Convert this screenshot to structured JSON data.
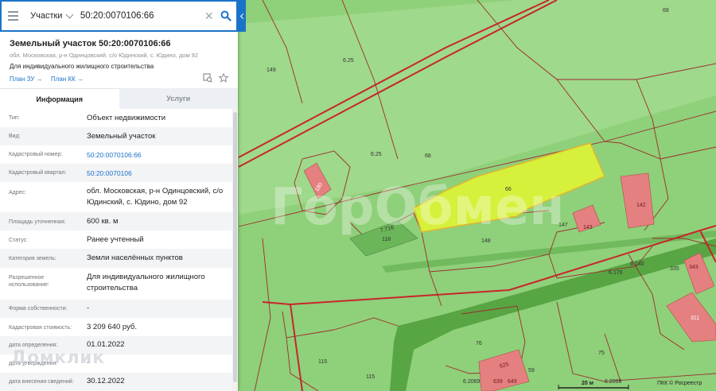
{
  "search": {
    "menu_icon": "menu-icon",
    "category": "Участки",
    "query": "50:20:0070106:66",
    "clear_icon": "close-icon",
    "search_icon": "search-icon"
  },
  "object": {
    "title": "Земельный участок 50:20:0070106:66",
    "address": "обл. Московская, р-н Одинцовский, с/о Юдинский, с. Юдино, дом 92",
    "use": "Для индивидуального жилищного строительства",
    "plan_zu": "План ЗУ →",
    "plan_kk": "План КК →",
    "tool_icons": [
      "map-zoom-icon",
      "star-icon"
    ]
  },
  "tabs": [
    {
      "label": "Информация",
      "active": true
    },
    {
      "label": "Услуги",
      "active": false
    }
  ],
  "info_rows": [
    {
      "key": "Тип:",
      "value": "Объект недвижимости"
    },
    {
      "key": "Вид:",
      "value": "Земельный участок"
    },
    {
      "key": "Кадастровый номер:",
      "value": "50:20:0070106:66",
      "link": true
    },
    {
      "key": "Кадастровый квартал:",
      "value": "50:20:0070106",
      "link": true
    },
    {
      "key": "Адрес:",
      "value": "обл. Московская, р-н Одинцовский, с/о Юдинский, с. Юдино, дом 92"
    },
    {
      "key": "Площадь уточненная:",
      "value": "600 кв. м"
    },
    {
      "key": "Статус:",
      "value": "Ранее учтенный"
    },
    {
      "key": "Категория земель:",
      "value": "Земли населённых пунктов"
    },
    {
      "key": "Разрешенное использование:",
      "value": "Для индивидуального жилищного строительства"
    },
    {
      "key": "Форма собственности:",
      "value": "-"
    },
    {
      "key": "Кадастровая стоимость:",
      "value": "3 209 640 руб."
    },
    {
      "key": "дата определения:",
      "value": "01.01.2022"
    },
    {
      "key": "дата утверждения:",
      "value": "-"
    },
    {
      "key": "дата внесения сведений:",
      "value": "30.12.2022"
    }
  ],
  "watermarks": {
    "map": "ГорОбмен",
    "panel": "Домклик"
  },
  "map_labels": {
    "l68a": "68",
    "l6_25a": "6.25",
    "l149": "149",
    "l6_25b": "6.25",
    "l68b": "68",
    "l180": "180",
    "l66": "66",
    "l7716": "7.716",
    "l118": "118",
    "l148": "148",
    "l147": "147",
    "l143": "143",
    "l142": "142",
    "l6140": "6.140",
    "l6176": "6.176",
    "l335": "335",
    "l343": "343",
    "l311": "311",
    "l76": "76",
    "l75": "75",
    "l115a": "115",
    "l115b": "115",
    "l625": "625",
    "l59": "59",
    "l639": "639",
    "l649": "649",
    "l62069": "6.2069",
    "l62068": "6.2068"
  },
  "scale": {
    "label": "20 м"
  },
  "attribution": "ПКК © Росреестр",
  "colors": {
    "accent": "#1a73c9",
    "map_green": "#8fd07a",
    "parcel_line": "#a52828",
    "highlight": "#d6f03c",
    "building": "#e58080"
  }
}
